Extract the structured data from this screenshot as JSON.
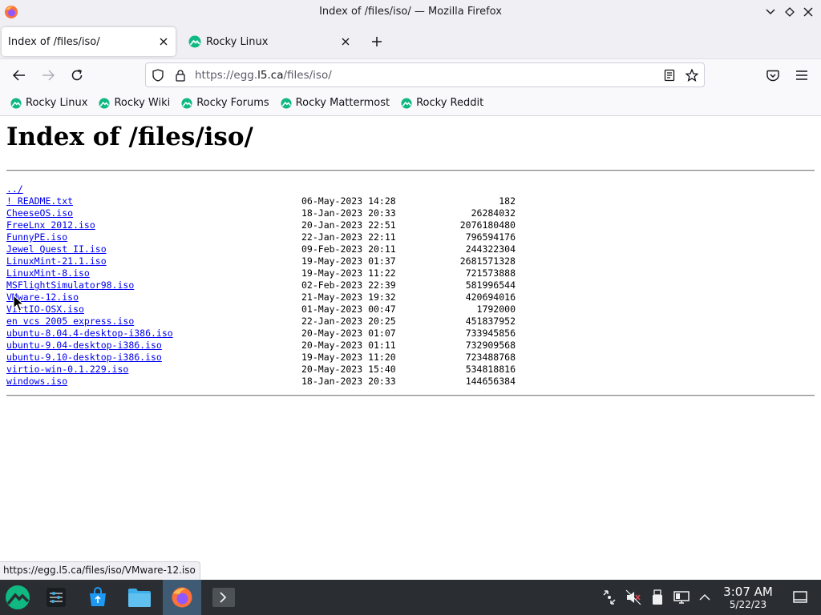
{
  "window": {
    "title": "Index of /files/iso/ — Mozilla Firefox"
  },
  "tabs": [
    {
      "label": "Index of /files/iso/",
      "active": true
    },
    {
      "label": "Rocky Linux",
      "active": false
    }
  ],
  "navbar": {
    "url_prefix": "https://egg.",
    "url_host": "l5.ca",
    "url_path": "/files/iso/"
  },
  "bookmarks": [
    {
      "label": "Rocky Linux"
    },
    {
      "label": "Rocky Wiki"
    },
    {
      "label": "Rocky Forums"
    },
    {
      "label": "Rocky Mattermost"
    },
    {
      "label": "Rocky Reddit"
    }
  ],
  "page": {
    "heading": "Index of /files/iso/",
    "parent_link": "../",
    "files": [
      {
        "name": "! README.txt",
        "date": "06-May-2023 14:28",
        "size": "182"
      },
      {
        "name": "CheeseOS.iso",
        "date": "18-Jan-2023 20:33",
        "size": "26284032"
      },
      {
        "name": "FreeLnx 2012.iso",
        "date": "20-Jan-2023 22:51",
        "size": "2076180480"
      },
      {
        "name": "FunnyPE.iso",
        "date": "22-Jan-2023 22:11",
        "size": "796594176"
      },
      {
        "name": "Jewel Quest II.iso",
        "date": "09-Feb-2023 20:11",
        "size": "244322304"
      },
      {
        "name": "LinuxMint-21.1.iso",
        "date": "19-May-2023 01:37",
        "size": "2681571328"
      },
      {
        "name": "LinuxMint-8.iso",
        "date": "19-May-2023 11:22",
        "size": "721573888"
      },
      {
        "name": "MSFlightSimulator98.iso",
        "date": "02-Feb-2023 22:39",
        "size": "581996544"
      },
      {
        "name": "VMware-12.iso",
        "date": "21-May-2023 19:32",
        "size": "420694016"
      },
      {
        "name": "VirtIO-OSX.iso",
        "date": "01-May-2023 00:47",
        "size": "1792000"
      },
      {
        "name": "en vcs 2005 express.iso",
        "date": "22-Jan-2023 20:25",
        "size": "451837952"
      },
      {
        "name": "ubuntu-8.04.4-desktop-i386.iso",
        "date": "20-May-2023 01:07",
        "size": "733945856"
      },
      {
        "name": "ubuntu-9.04-desktop-i386.iso",
        "date": "20-May-2023 01:11",
        "size": "732909568"
      },
      {
        "name": "ubuntu-9.10-desktop-i386.iso",
        "date": "19-May-2023 11:20",
        "size": "723488768"
      },
      {
        "name": "virtio-win-0.1.229.iso",
        "date": "20-May-2023 15:40",
        "size": "534818816"
      },
      {
        "name": "windows.iso",
        "date": "18-Jan-2023 20:33",
        "size": "144656384"
      }
    ]
  },
  "status": {
    "hover_url": "https://egg.l5.ca/files/iso/VMware-12.iso"
  },
  "taskbar": {
    "time": "3:07 AM",
    "date": "5/22/23"
  },
  "colors": {
    "link": "#0000ee",
    "taskbar_bg": "#2a2e32",
    "rocky_green": "#10b981"
  }
}
